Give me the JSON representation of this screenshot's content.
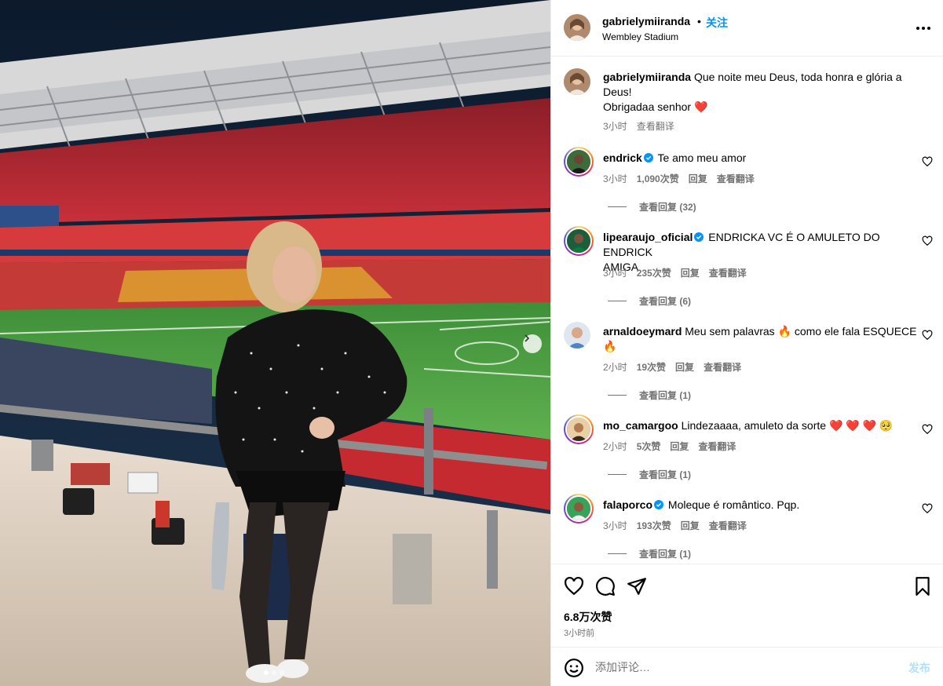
{
  "post": {
    "author": "gabrielymiiranda",
    "separator": "•",
    "follow_label": "关注",
    "location": "Wembley Stadium",
    "more_icon": "more-horizontal-icon"
  },
  "caption": {
    "username": "gabrielymiiranda",
    "text_line1": "Que noite meu Deus, toda honra e glória a",
    "text_line2": "Deus!",
    "text_line3": "Obrigadaa senhor ❤️",
    "time": "3小时",
    "translate": "查看翻译"
  },
  "comments": [
    {
      "username": "endrick",
      "verified": true,
      "text": "Te amo meu amor",
      "text2": "",
      "time": "3小时",
      "likes": "1,090次赞",
      "reply": "回复",
      "translate": "查看翻译",
      "view_replies": "查看回复 (32)"
    },
    {
      "username": "lipearaujo_oficial",
      "verified": true,
      "text": "ENDRICKA VC É O AMULETO DO ENDRICK",
      "text2": "AMIGA",
      "time": "3小时",
      "likes": "235次赞",
      "reply": "回复",
      "translate": "查看翻译",
      "view_replies": "查看回复 (6)"
    },
    {
      "username": "arnaldoeymard",
      "verified": false,
      "text": "Meu sem palavras 🔥 como ele fala ESQUECE",
      "text2": "🔥",
      "time": "2小时",
      "likes": "19次赞",
      "reply": "回复",
      "translate": "查看翻译",
      "view_replies": "查看回复 (1)"
    },
    {
      "username": "mo_camargoo",
      "verified": false,
      "text": "Lindezaaaa, amuleto da sorte ❤️ ❤️ ❤️ 🥺",
      "text2": "",
      "time": "2小时",
      "likes": "5次赞",
      "reply": "回复",
      "translate": "查看翻译",
      "view_replies": "查看回复 (1)"
    },
    {
      "username": "falaporco",
      "verified": true,
      "text": "Moleque é romântico. Pqp.",
      "text2": "",
      "time": "3小时",
      "likes": "193次赞",
      "reply": "回复",
      "translate": "查看翻译",
      "view_replies": "查看回复 (1)"
    }
  ],
  "actions": {
    "icons": [
      "heart-icon",
      "comment-icon",
      "share-icon",
      "bookmark-icon"
    ],
    "likes": "6.8万次赞",
    "posted": "3小时前"
  },
  "composer": {
    "placeholder": "添加评论…",
    "post_label": "发布"
  },
  "carousel": {
    "current_slide": 1,
    "total_slides": 3
  },
  "colors": {
    "link_blue": "#0095f6",
    "muted": "#737373",
    "post_disabled": "#b2dffc"
  }
}
